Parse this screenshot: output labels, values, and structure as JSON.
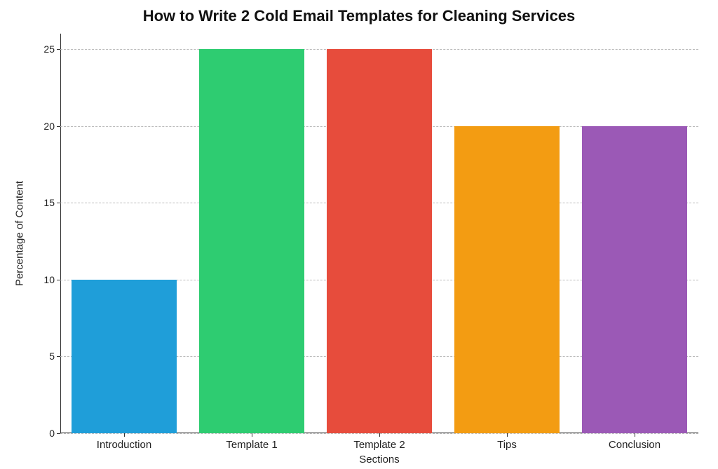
{
  "chart_data": {
    "type": "bar",
    "title": "How to Write 2 Cold Email Templates for Cleaning Services",
    "xlabel": "Sections",
    "ylabel": "Percentage of Content",
    "categories": [
      "Introduction",
      "Template 1",
      "Template 2",
      "Tips",
      "Conclusion"
    ],
    "values": [
      10,
      25,
      25,
      20,
      20
    ],
    "colors": [
      "#1f9ed9",
      "#2ecc71",
      "#e74c3c",
      "#f39c12",
      "#9b59b6"
    ],
    "ylim": [
      0,
      26
    ],
    "yticks": [
      0,
      5,
      10,
      15,
      20,
      25
    ],
    "grid": true
  }
}
